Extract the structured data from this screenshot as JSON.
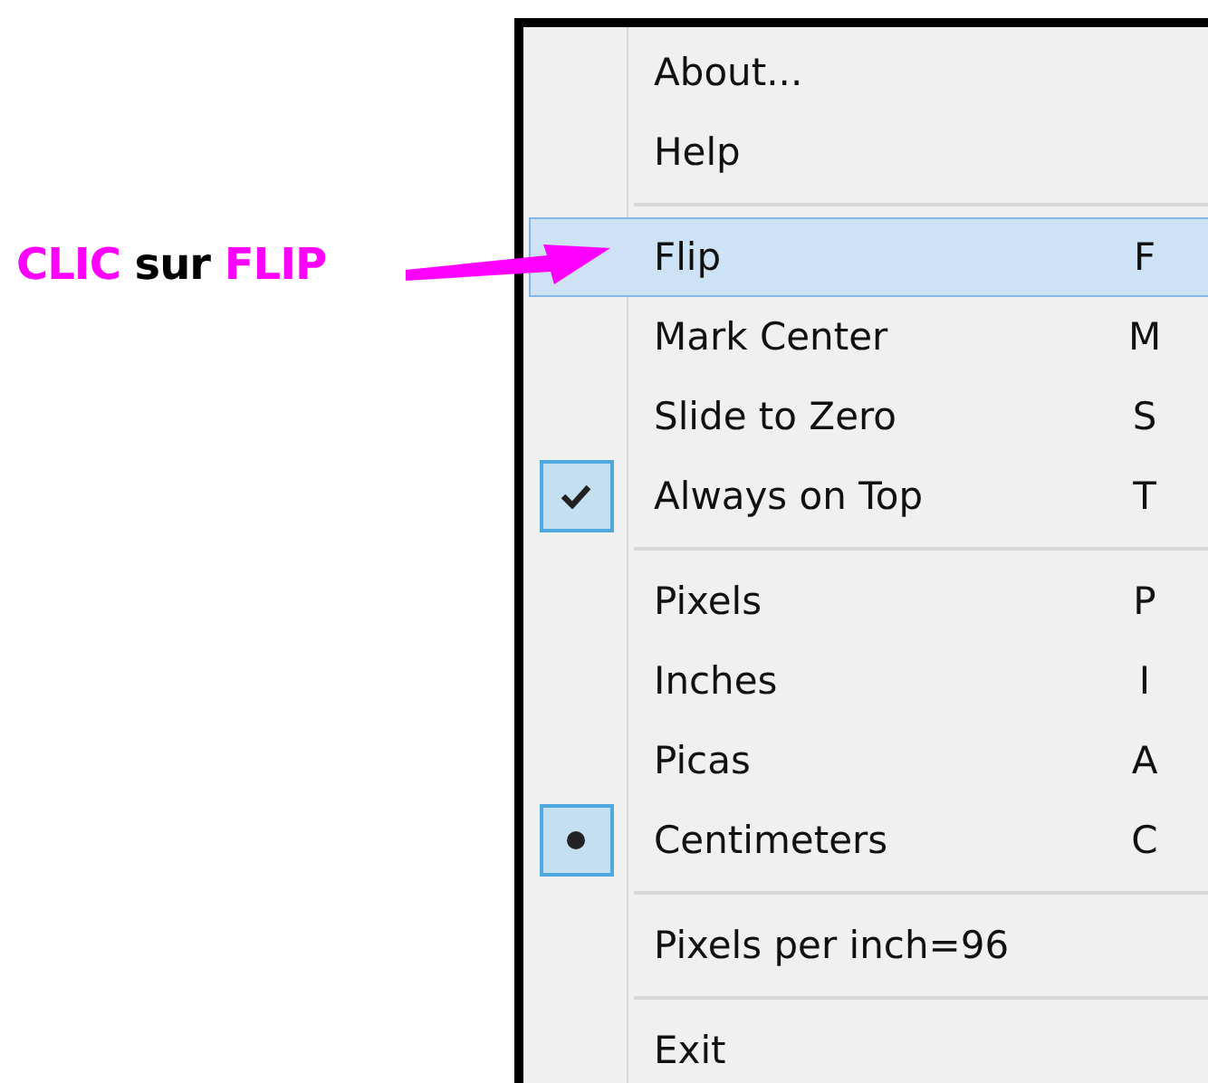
{
  "annotation": {
    "text": "**CLIC** sur **FLIP**"
  },
  "menu": {
    "items": [
      {
        "kind": "command",
        "label": "About...",
        "selected": false
      },
      {
        "kind": "command",
        "label": "Help",
        "selected": false
      },
      {
        "kind": "separator"
      },
      {
        "kind": "command",
        "label": "Flip",
        "shortcut": "F",
        "selected": true
      },
      {
        "kind": "command",
        "label": "Mark Center",
        "shortcut": "M",
        "selected": false
      },
      {
        "kind": "command",
        "label": "Slide to Zero",
        "shortcut": "S",
        "selected": false
      },
      {
        "kind": "toggle",
        "label": "Always on Top",
        "shortcut": "T",
        "checked": true,
        "selected": false
      },
      {
        "kind": "separator"
      },
      {
        "kind": "radio",
        "label": "Pixels",
        "shortcut": "P",
        "checked": false,
        "selected": false
      },
      {
        "kind": "radio",
        "label": "Inches",
        "shortcut": "I",
        "checked": false,
        "selected": false
      },
      {
        "kind": "radio",
        "label": "Picas",
        "shortcut": "A",
        "checked": false,
        "selected": false
      },
      {
        "kind": "radio",
        "label": "Centimeters",
        "shortcut": "C",
        "checked": true,
        "selected": false
      },
      {
        "kind": "separator"
      },
      {
        "kind": "command",
        "label": "Pixels per inch=96",
        "selected": false
      },
      {
        "kind": "separator"
      },
      {
        "kind": "command",
        "label": "Exit",
        "selected": false
      }
    ]
  }
}
